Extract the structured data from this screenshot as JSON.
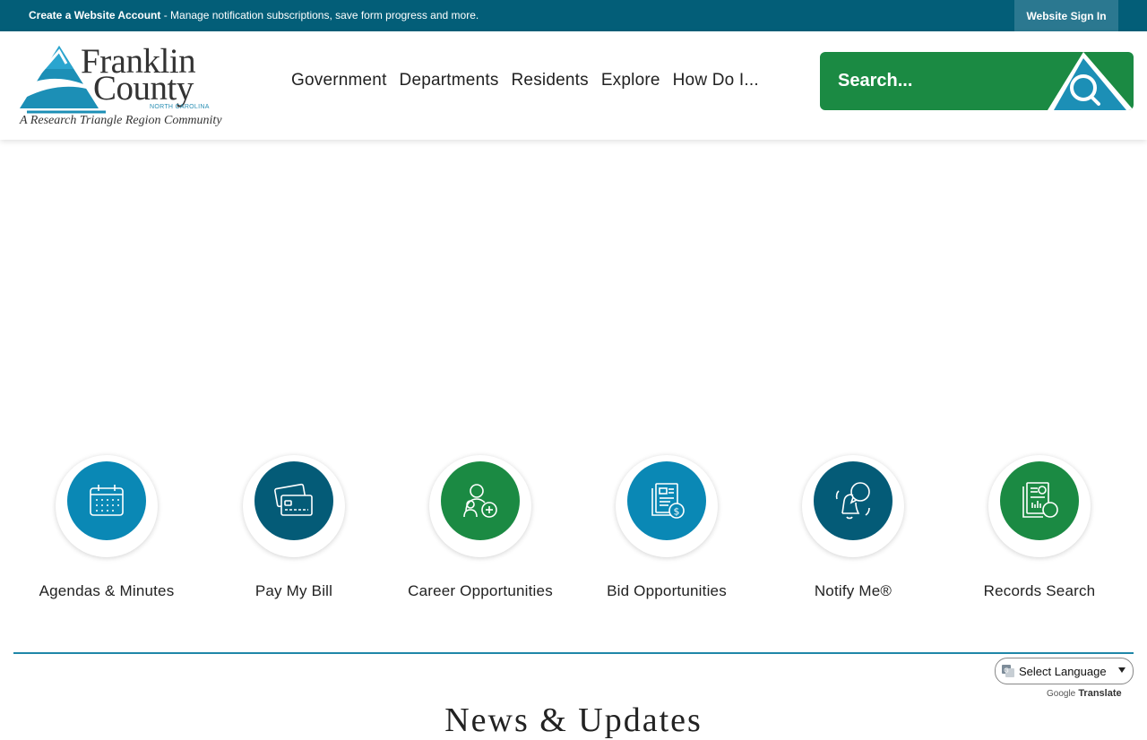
{
  "topbar": {
    "account_link": "Create a Website Account",
    "account_message": " - Manage notification subscriptions, save form progress and more.",
    "signin_label": "Website Sign In"
  },
  "logo": {
    "line1": "Franklin",
    "line2": "County",
    "state": "NORTH CAROLINA",
    "tagline": "A Research Triangle Region Community"
  },
  "nav": {
    "items": [
      "Government",
      "Departments",
      "Residents",
      "Explore",
      "How Do I..."
    ]
  },
  "search": {
    "placeholder": "Search...",
    "icon": "search-icon"
  },
  "quick_links": [
    {
      "label": "Agendas & Minutes",
      "icon": "calendar-icon",
      "color": "#0a88b5"
    },
    {
      "label": "Pay My Bill",
      "icon": "credit-card-icon",
      "color": "#045b77"
    },
    {
      "label": "Career Opportunities",
      "icon": "people-add-icon",
      "color": "#1b8a43"
    },
    {
      "label": "Bid Opportunities",
      "icon": "document-dollar-icon",
      "color": "#0a88b5"
    },
    {
      "label": "Notify Me®",
      "icon": "bell-chat-icon",
      "color": "#045b77"
    },
    {
      "label": "Records Search",
      "icon": "records-search-icon",
      "color": "#1b8a43"
    }
  ],
  "news": {
    "heading": "News & Updates"
  },
  "translate": {
    "select_label": "Select Language",
    "powered_by": "Google",
    "translate_word": "Translate"
  },
  "colors": {
    "topbar": "#035e78",
    "accent_green": "#1b8a43",
    "accent_blue": "#0a88b5",
    "accent_navy": "#045b77"
  }
}
